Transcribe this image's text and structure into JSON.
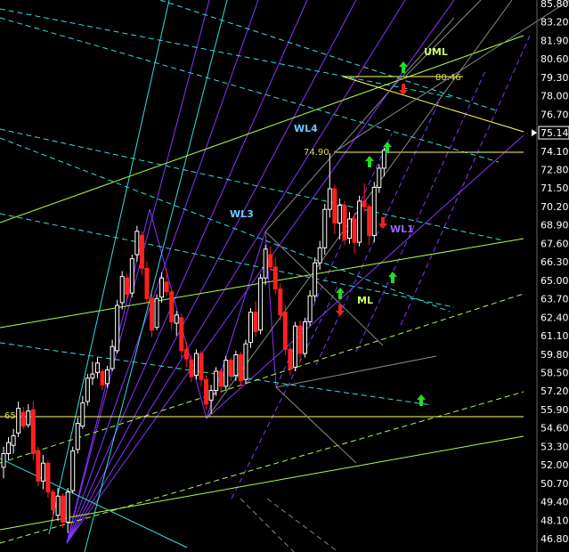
{
  "chart_data": {
    "type": "candlestick",
    "y_axis": {
      "ylim": [
        46.8,
        85.8
      ],
      "ticks": [
        "85.80",
        "83.20",
        "81.90",
        "80.60",
        "79.30",
        "78.00",
        "76.70",
        "75.14",
        "74.10",
        "72.80",
        "71.50",
        "70.20",
        "68.90",
        "67.60",
        "66.30",
        "65.00",
        "63.70",
        "62.40",
        "61.10",
        "59.80",
        "58.50",
        "57.20",
        "55.90",
        "54.60",
        "53.30",
        "52.00",
        "50.70",
        "49.40",
        "48.10",
        "46.80"
      ],
      "last_price": "75.14"
    },
    "candles": [
      [
        52.0,
        53.5,
        51.2,
        53.0
      ],
      [
        53.0,
        54.2,
        52.5,
        53.8
      ],
      [
        53.6,
        54.8,
        53.0,
        54.3
      ],
      [
        54.5,
        56.8,
        54.2,
        56.3
      ],
      [
        56.0,
        56.4,
        54.8,
        55.0
      ],
      [
        55.1,
        56.6,
        54.9,
        56.1
      ],
      [
        56.2,
        56.8,
        52.5,
        53.0
      ],
      [
        53.2,
        53.5,
        50.6,
        51.0
      ],
      [
        51.0,
        52.9,
        50.4,
        52.3
      ],
      [
        52.3,
        52.5,
        49.8,
        50.2
      ],
      [
        50.2,
        50.4,
        48.2,
        48.9
      ],
      [
        48.5,
        50.5,
        48.1,
        49.9
      ],
      [
        49.9,
        50.1,
        47.6,
        48.0
      ],
      [
        48.0,
        50.5,
        47.2,
        50.2
      ],
      [
        50.3,
        53.5,
        50.1,
        53.2
      ],
      [
        53.3,
        55.6,
        53.0,
        55.2
      ],
      [
        55.0,
        57.2,
        54.8,
        56.7
      ],
      [
        56.8,
        58.8,
        56.5,
        58.5
      ],
      [
        58.5,
        59.7,
        58.0,
        58.8
      ],
      [
        58.9,
        60.0,
        58.5,
        59.6
      ],
      [
        59.0,
        59.2,
        57.6,
        58.0
      ],
      [
        58.1,
        59.4,
        57.8,
        59.1
      ],
      [
        59.2,
        61.3,
        59.0,
        60.8
      ],
      [
        60.5,
        64.2,
        60.3,
        63.8
      ],
      [
        64.0,
        66.3,
        63.5,
        65.9
      ],
      [
        65.8,
        66.1,
        64.2,
        64.6
      ],
      [
        64.7,
        67.5,
        64.4,
        67.2
      ],
      [
        67.5,
        69.6,
        67.0,
        69.2
      ],
      [
        68.9,
        69.2,
        66.0,
        66.5
      ],
      [
        66.5,
        67.0,
        63.9,
        64.3
      ],
      [
        64.3,
        64.8,
        61.5,
        62.0
      ],
      [
        62.2,
        64.6,
        62.0,
        64.3
      ],
      [
        64.4,
        66.2,
        64.0,
        65.8
      ],
      [
        65.5,
        66.5,
        64.5,
        64.8
      ],
      [
        64.8,
        65.0,
        62.0,
        62.6
      ],
      [
        62.5,
        63.4,
        61.6,
        63.1
      ],
      [
        62.9,
        63.2,
        60.0,
        60.5
      ],
      [
        60.6,
        61.1,
        59.3,
        59.9
      ],
      [
        59.8,
        60.2,
        58.2,
        58.6
      ],
      [
        58.7,
        60.6,
        58.4,
        60.3
      ],
      [
        60.3,
        60.5,
        57.9,
        58.4
      ],
      [
        58.4,
        58.7,
        56.2,
        56.6
      ],
      [
        56.9,
        58.0,
        55.9,
        57.6
      ],
      [
        57.6,
        59.3,
        57.2,
        59.0
      ],
      [
        59.0,
        59.2,
        57.4,
        57.9
      ],
      [
        57.9,
        60.1,
        57.6,
        59.8
      ],
      [
        59.8,
        60.0,
        58.3,
        58.7
      ],
      [
        58.7,
        60.5,
        58.3,
        60.2
      ],
      [
        60.2,
        60.4,
        57.9,
        58.3
      ],
      [
        58.4,
        61.3,
        58.1,
        61.0
      ],
      [
        61.1,
        63.6,
        60.7,
        63.3
      ],
      [
        63.3,
        64.1,
        61.5,
        61.9
      ],
      [
        62.0,
        66.1,
        61.7,
        65.8
      ],
      [
        65.8,
        68.2,
        65.3,
        67.9
      ],
      [
        67.5,
        68.1,
        66.3,
        66.6
      ],
      [
        66.6,
        67.3,
        64.6,
        65.0
      ],
      [
        65.0,
        65.4,
        62.7,
        63.1
      ],
      [
        63.3,
        63.8,
        60.2,
        60.6
      ],
      [
        60.6,
        60.9,
        58.7,
        59.2
      ],
      [
        59.3,
        62.6,
        59.0,
        62.3
      ],
      [
        62.3,
        62.7,
        59.7,
        60.3
      ],
      [
        60.3,
        62.9,
        60.0,
        62.6
      ],
      [
        62.6,
        64.9,
        62.3,
        64.5
      ],
      [
        64.5,
        67.3,
        64.1,
        66.9
      ],
      [
        66.9,
        68.5,
        66.4,
        68.0
      ],
      [
        68.0,
        71.2,
        67.5,
        70.8
      ],
      [
        70.8,
        74.9,
        70.2,
        72.3
      ],
      [
        72.3,
        72.6,
        69.0,
        69.8
      ],
      [
        69.8,
        71.6,
        68.6,
        71.1
      ],
      [
        71.1,
        71.4,
        68.2,
        68.6
      ],
      [
        68.7,
        70.6,
        68.3,
        70.1
      ],
      [
        70.1,
        70.5,
        67.6,
        68.4
      ],
      [
        68.4,
        71.8,
        68.1,
        71.4
      ],
      [
        71.4,
        72.7,
        70.6,
        71.0
      ],
      [
        71.0,
        71.2,
        68.2,
        68.9
      ],
      [
        68.9,
        72.8,
        68.4,
        72.4
      ],
      [
        72.4,
        74.1,
        72.0,
        73.8
      ],
      [
        73.8,
        75.3,
        73.2,
        75.1
      ]
    ],
    "annotations": [
      {
        "text": "UML",
        "color": "#ccff66"
      },
      {
        "text": "80.46",
        "color": "#dddd55"
      },
      {
        "text": "WL4",
        "color": "#66ccff"
      },
      {
        "text": "74.90",
        "color": "#dddd55"
      },
      {
        "text": "WL3",
        "color": "#66ccff"
      },
      {
        "text": "WL1",
        "color": "#9966ff"
      },
      {
        "text": "ML",
        "color": "#ccff66"
      },
      {
        "text": "65",
        "color": "#dddd55"
      }
    ],
    "colors": {
      "up": "#ffffff",
      "down": "#ff2020",
      "background": "#000000",
      "purple": "#8833ff",
      "cyan": "#33dddd",
      "yellow": "#ffff66",
      "green": "#aaff44",
      "gray": "#888888",
      "arrow_up": "#22dd22",
      "arrow_down": "#ee2222"
    }
  }
}
